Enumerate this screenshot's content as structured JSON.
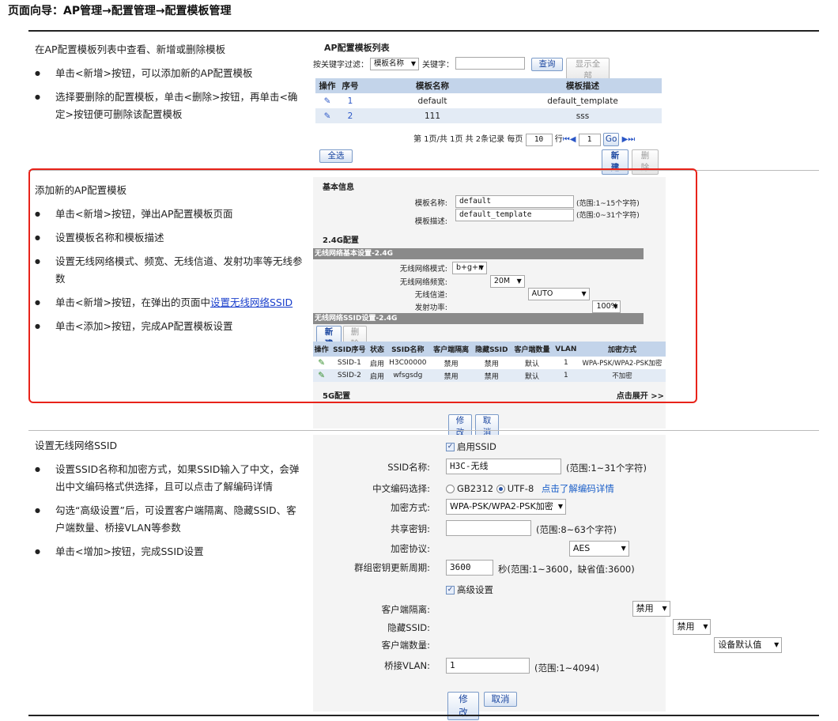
{
  "page": {
    "nav_title": "页面向导：AP管理→配置管理→配置模板管理"
  },
  "section1": {
    "heading": "在AP配置模板列表中查看、新增或删除模板",
    "bullets": [
      "单击<新增>按钮，可以添加新的AP配置模板",
      "选择要删除的配置模板，单击<删除>按钮，再单击<确定>按钮便可删除该配置模板"
    ],
    "panel": {
      "title": "AP配置模板列表",
      "filter_label": "按关键字过滤：",
      "filter_select": "模板名称",
      "keyword_label": "关键字：",
      "keyword_value": "",
      "query_button": "查询",
      "show_all_button": "显示全部",
      "columns": [
        "操作",
        "序号",
        "模板名称",
        "模板描述"
      ],
      "rows": [
        {
          "index": "1",
          "name": "default",
          "desc": "default_template"
        },
        {
          "index": "2",
          "name": "111",
          "desc": "sss"
        }
      ],
      "pager_text": "第 1页/共 1页 共 2条记录 每页",
      "per_page": "10",
      "row_label": "行",
      "page_input": "1",
      "go_button": "Go",
      "select_all_button": "全选",
      "new_button": "新建",
      "delete_button": "删除"
    }
  },
  "section2": {
    "heading": "添加新的AP配置模板",
    "bullets": [
      "单击<新增>按钮，弹出AP配置模板页面",
      "设置模板名称和模板描述",
      "设置无线网络模式、频宽、无线信道、发射功率等无线参数"
    ],
    "bullet4_prefix": "单击<新增>按钮，在弹出的页面中",
    "bullet4_link": "设置无线网络SSID",
    "bullet5": "单击<添加>按钮，完成AP配置模板设置",
    "panel": {
      "basic_title": "基本信息",
      "name_label": "模板名称:",
      "name_value": "default",
      "name_hint": "(范围:1~15个字符)",
      "desc_label": "模板描述:",
      "desc_value": "default_template",
      "desc_hint": "(范围:0~31个字符)",
      "config24_title": "2.4G配置",
      "basic_bar": "无线网络基本设置-2.4G",
      "mode_label": "无线网络模式:",
      "mode_value": "b+g+n",
      "bandwidth_label": "无线网络频宽:",
      "bandwidth_value": "20M",
      "channel_label": "无线信道:",
      "channel_value": "AUTO",
      "power_label": "发射功率:",
      "power_value": "100%",
      "ssid_bar": "无线网络SSID设置-2.4G",
      "new_button": "新建",
      "delete_button": "删除",
      "columns": [
        "操作",
        "SSID序号",
        "状态",
        "SSID名称",
        "客户端隔离",
        "隐藏SSID",
        "客户端数量",
        "VLAN",
        "加密方式"
      ],
      "rows": [
        {
          "seq": "SSID-1",
          "status": "启用",
          "name": "H3C00000",
          "isolate": "禁用",
          "hide": "禁用",
          "count": "默认",
          "vlan": "1",
          "enc": "WPA-PSK/WPA2-PSK加密"
        },
        {
          "seq": "SSID-2",
          "status": "启用",
          "name": "wfsgsdg",
          "isolate": "禁用",
          "hide": "禁用",
          "count": "默认",
          "vlan": "1",
          "enc": "不加密"
        }
      ],
      "config5_title": "5G配置",
      "expand_link": "点击展开 >>",
      "modify_button": "修改",
      "cancel_button": "取消"
    }
  },
  "section3": {
    "heading": "设置无线网络SSID",
    "bullets": [
      "设置SSID名称和加密方式，如果SSID输入了中文，会弹出中文编码格式供选择，且可以点击了解编码详情",
      "勾选“高级设置”后，可设置客户端隔离、隐藏SSID、客户端数量、桥接VLAN等参数",
      "单击<增加>按钮，完成SSID设置"
    ],
    "panel": {
      "enable_ssid": "启用SSID",
      "ssid_name_label": "SSID名称:",
      "ssid_name_value": "H3C-无线",
      "ssid_name_hint": "(范围:1~31个字符)",
      "encoding_label": "中文编码选择:",
      "encoding_options": [
        "GB2312",
        "UTF-8"
      ],
      "encoding_link": "点击了解编码详情",
      "enc_label": "加密方式:",
      "enc_value": "WPA-PSK/WPA2-PSK加密",
      "key_label": "共享密钥:",
      "key_value": "",
      "key_hint": "(范围:8~63个字符)",
      "protocol_label": "加密协议:",
      "protocol_value": "AES",
      "period_label": "群组密钥更新周期:",
      "period_value": "3600",
      "period_hint": "秒(范围:1~3600，缺省值:3600)",
      "advanced": "高级设置",
      "isolate_label": "客户端隔离:",
      "isolate_value": "禁用",
      "hide_label": "隐藏SSID:",
      "hide_value": "禁用",
      "count_label": "客户端数量:",
      "count_value": "设备默认值",
      "vlan_label": "桥接VLAN:",
      "vlan_value": "1",
      "vlan_hint": "(范围:1~4094)",
      "modify_button": "修改",
      "cancel_button": "取消"
    }
  }
}
